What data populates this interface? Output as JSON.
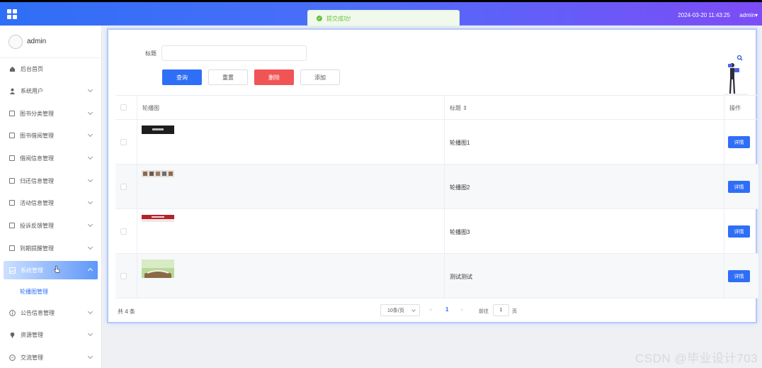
{
  "topbar": {
    "datetime": "2024-03-20 11:43:25",
    "user": "admin▾"
  },
  "toast": {
    "message": "提交成功!",
    "color": "#67c23a"
  },
  "sidebar": {
    "user": "admin",
    "items": [
      {
        "label": "后台首页",
        "icon": "home-icon"
      },
      {
        "label": "系统用户",
        "icon": "user-icon"
      },
      {
        "label": "图书分类管理",
        "icon": "doc-icon"
      },
      {
        "label": "图书借阅管理",
        "icon": "doc-icon"
      },
      {
        "label": "借阅信息管理",
        "icon": "doc-icon"
      },
      {
        "label": "归还信息管理",
        "icon": "doc-icon"
      },
      {
        "label": "活动信息管理",
        "icon": "doc-icon"
      },
      {
        "label": "投诉反馈管理",
        "icon": "doc-icon"
      },
      {
        "label": "到期提醒管理",
        "icon": "doc-icon"
      },
      {
        "label": "系统管理",
        "icon": "image-icon"
      },
      {
        "label": "公告信息管理",
        "icon": "info-icon"
      },
      {
        "label": "资源管理",
        "icon": "pin-icon"
      },
      {
        "label": "交流管理",
        "icon": "chat-icon"
      }
    ],
    "active_index": 9,
    "submenu": "轮播图管理"
  },
  "search": {
    "label": "标题",
    "value": ""
  },
  "buttons": {
    "query": "查询",
    "reset": "重置",
    "delete": "删除",
    "add": "添加"
  },
  "table": {
    "headers": {
      "image": "轮播图",
      "title": "标题 ⇕",
      "action": "操作"
    },
    "rows": [
      {
        "title": "轮播图1",
        "action": "详情"
      },
      {
        "title": "轮播图2",
        "action": "详情"
      },
      {
        "title": "轮播图3",
        "action": "详情"
      },
      {
        "title": "测试测试",
        "action": "详情"
      }
    ]
  },
  "pagination": {
    "total": "共 4 条",
    "page_size": "10条/页",
    "current_page": "1",
    "goto_label": "前往",
    "goto_value": "1",
    "goto_unit": "页"
  },
  "watermark": "CSDN @毕业设计703",
  "colors": {
    "primary": "#2f6ef6",
    "danger": "#f05454",
    "header_end": "#7d4cf6"
  }
}
